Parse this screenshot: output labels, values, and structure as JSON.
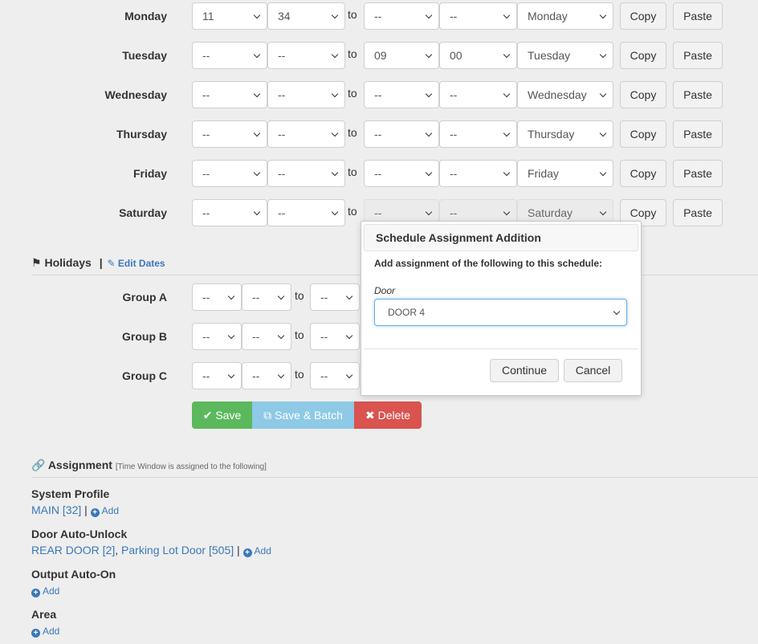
{
  "schedule": {
    "to_label": "to",
    "copy_label": "Copy",
    "paste_label": "Paste",
    "days": [
      {
        "label": "Monday",
        "start_hour": "11",
        "start_min": "34",
        "end_hour": "--",
        "end_min": "--",
        "end_day": "Monday"
      },
      {
        "label": "Tuesday",
        "start_hour": "--",
        "start_min": "--",
        "end_hour": "09",
        "end_min": "00",
        "end_day": "Tuesday"
      },
      {
        "label": "Wednesday",
        "start_hour": "--",
        "start_min": "--",
        "end_hour": "--",
        "end_min": "--",
        "end_day": "Wednesday"
      },
      {
        "label": "Thursday",
        "start_hour": "--",
        "start_min": "--",
        "end_hour": "--",
        "end_min": "--",
        "end_day": "Thursday"
      },
      {
        "label": "Friday",
        "start_hour": "--",
        "start_min": "--",
        "end_hour": "--",
        "end_min": "--",
        "end_day": "Friday"
      },
      {
        "label": "Saturday",
        "start_hour": "--",
        "start_min": "--",
        "end_hour": "--",
        "end_min": "--",
        "end_day": "Saturday"
      }
    ]
  },
  "holidays": {
    "title": "Holidays",
    "separator": "|",
    "edit_dates_label": "Edit Dates",
    "groups": [
      {
        "label": "Group A",
        "start_month": "--",
        "start_day": "--",
        "end_month": "--"
      },
      {
        "label": "Group B",
        "start_month": "--",
        "start_day": "--",
        "end_month": "--"
      },
      {
        "label": "Group C",
        "start_month": "--",
        "start_day": "--",
        "end_month": "--"
      }
    ]
  },
  "actions": {
    "save_label": "Save",
    "save_batch_label": "Save & Batch",
    "delete_label": "Delete",
    "colors": {
      "save": "#5cb85c",
      "save_batch": "#8ec9e6",
      "delete": "#d9534f"
    }
  },
  "assignment": {
    "title": "Assignment",
    "subtitle": "[Time Window is assigned to the following]",
    "add_label": "Add",
    "system_profile": {
      "title": "System Profile",
      "link": "MAIN [32]",
      "separator": "|"
    },
    "door_auto_unlock": {
      "title": "Door Auto-Unlock",
      "link_1": "REAR DOOR [2]",
      "comma": ",",
      "link_2": "Parking Lot Door [505]",
      "separator": "|"
    },
    "output_auto_on": {
      "title": "Output Auto-On"
    },
    "area": {
      "title": "Area"
    }
  },
  "modal": {
    "title": "Schedule Assignment Addition",
    "instruction": "Add assignment of the following to this schedule:",
    "field_label": "Door",
    "selected_value": "DOOR 4",
    "continue_label": "Continue",
    "cancel_label": "Cancel"
  },
  "icons": {
    "holidays": "flag-icon",
    "edit": "edit-icon",
    "save": "check-circle-icon",
    "save_batch": "copy-icon",
    "delete": "times-circle-icon",
    "assignment": "link-icon",
    "add": "plus-circle-icon"
  }
}
